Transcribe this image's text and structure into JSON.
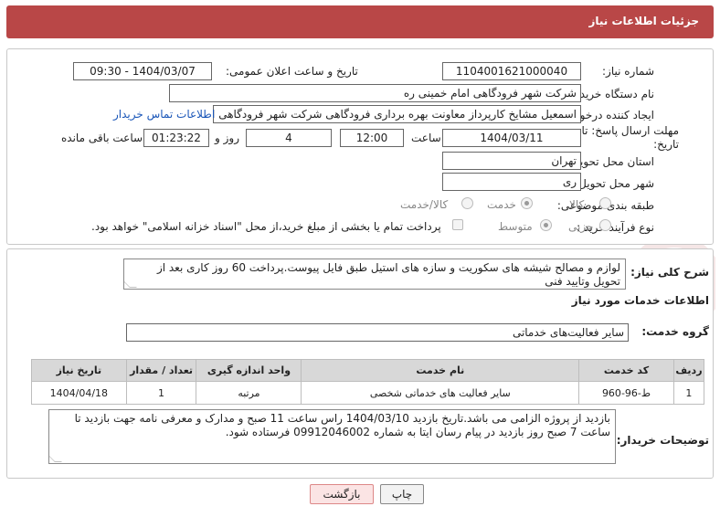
{
  "header": {
    "title": "جزئیات اطلاعات نیاز"
  },
  "form": {
    "need_number_label": "شماره نیاز:",
    "need_number": "1104001621000040",
    "announce_label": "تاریخ و ساعت اعلان عمومی:",
    "announce_value": "1404/03/07 - 09:30",
    "buyer_org_label": "نام دستگاه خریدار:",
    "buyer_org": "شرکت شهر فرودگاهی امام خمینی  ره",
    "creator_label": "ایجاد کننده درخواست:",
    "creator": "اسمعیل مشایخ کارپرداز معاونت بهره برداری فرودگاهی شرکت شهر فرودگاهی ا",
    "contact_link": "اطلاعات تماس خریدار",
    "deadline_label": "مهلت ارسال پاسخ: تا تاریخ:",
    "deadline_date": "1404/03/11",
    "time_label": "ساعت",
    "deadline_time": "12:00",
    "days_value": "4",
    "days_label": "روز و",
    "remaining_time": "01:23:22",
    "remaining_label": "ساعت باقی مانده",
    "province_label": "استان محل تحویل:",
    "province": "تهران",
    "city_label": "شهر محل تحویل:",
    "city": "ری",
    "category_label": "طبقه بندی موضوعی:",
    "category_options": [
      "کالا",
      "خدمت",
      "کالا/خدمت"
    ],
    "process_label": "نوع فرآیند خرید :",
    "process_options": [
      "جزیی",
      "متوسط"
    ],
    "payment_note": "پرداخت تمام یا بخشی از مبلغ خرید،از محل \"اسناد خزانه اسلامی\" خواهد بود."
  },
  "need_desc": {
    "label": "شرح کلی نیاز:",
    "text": "لوازم و مصالح شیشه های سکوریت و سازه های استیل طبق فایل پیوست.پرداخت 60 روز کاری بعد از تحویل وتایید فنی"
  },
  "services": {
    "heading": "اطلاعات خدمات مورد نیاز",
    "group_label": "گروه خدمت:",
    "group_value": "سایر فعالیت‌های خدماتی",
    "columns": [
      "ردیف",
      "کد خدمت",
      "نام خدمت",
      "واحد اندازه گیری",
      "تعداد / مقدار",
      "تاریخ نیاز"
    ],
    "rows": [
      [
        "1",
        "ط-96-960",
        "سایر فعالیت های خدماتی شخصی",
        "مرتبه",
        "1",
        "1404/04/18"
      ]
    ]
  },
  "buyer_notes": {
    "label": "توضیحات خریدار:",
    "text": "بازدید از پروژه الزامی می باشد.تاریخ بازدید 1404/03/10 راس ساعت 11 صبح و مدارک و معرفی نامه جهت بازدید تا ساعت 7 صبح روز بازدید در پیام رسان ایتا به شماره 09912046002 فرستاده شود."
  },
  "buttons": {
    "print": "چاپ",
    "back": "بازگشت"
  },
  "colors": {
    "header_bg": "#b94747",
    "link": "#1a56b8",
    "back_btn": "#fbe4e4"
  }
}
